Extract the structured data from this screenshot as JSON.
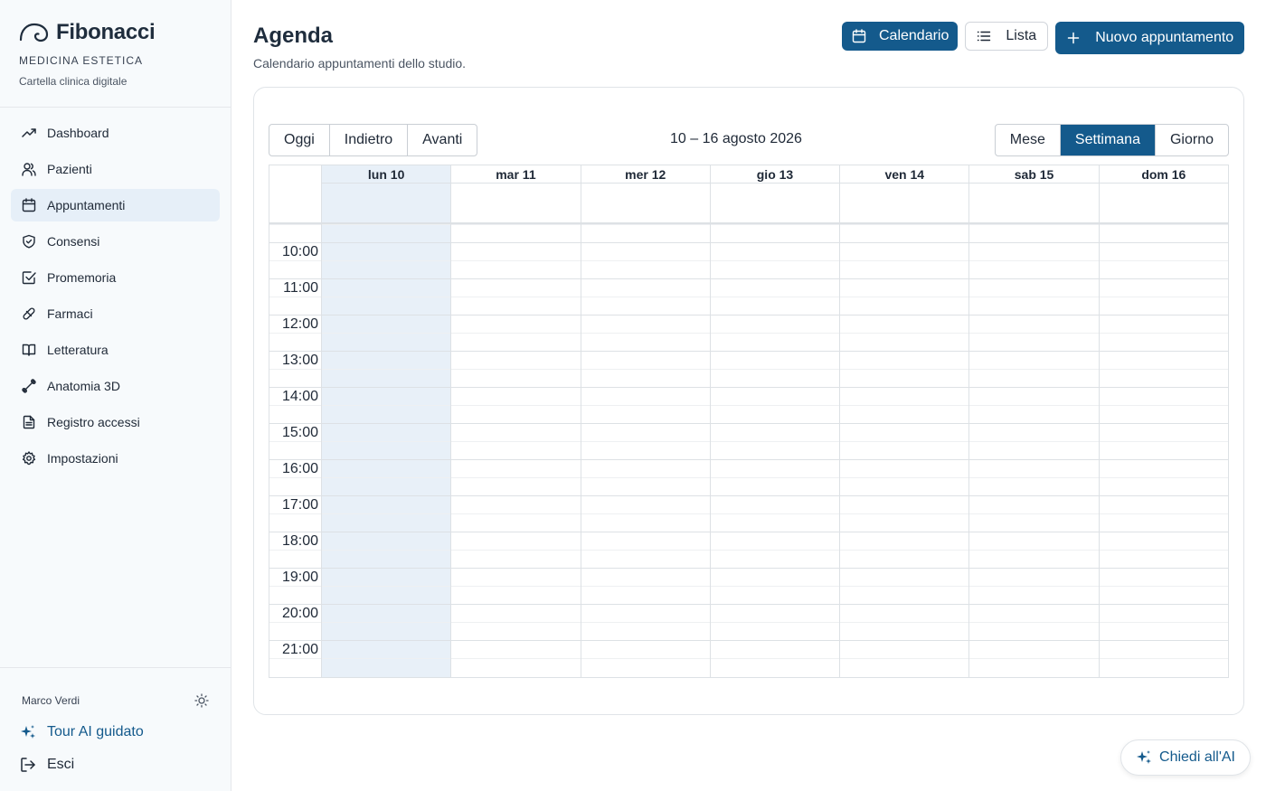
{
  "brand": {
    "name": "Fibonacci",
    "subtitle": "MEDICINA ESTETICA",
    "tagline": "Cartella clinica digitale"
  },
  "sidebar": {
    "items": [
      {
        "label": "Dashboard",
        "icon": "trending-up-icon"
      },
      {
        "label": "Pazienti",
        "icon": "users-icon"
      },
      {
        "label": "Appuntamenti",
        "icon": "calendar-icon",
        "active": true
      },
      {
        "label": "Consensi",
        "icon": "shield-check-icon"
      },
      {
        "label": "Promemoria",
        "icon": "checkbox-icon"
      },
      {
        "label": "Farmaci",
        "icon": "pill-icon"
      },
      {
        "label": "Letteratura",
        "icon": "book-open-icon"
      },
      {
        "label": "Anatomia 3D",
        "icon": "bone-icon"
      },
      {
        "label": "Registro accessi",
        "icon": "file-text-icon"
      },
      {
        "label": "Impostazioni",
        "icon": "gear-icon"
      }
    ],
    "user": "Marco Verdi",
    "tour": "Tour AI guidato",
    "logout": "Esci"
  },
  "page": {
    "title": "Agenda",
    "subtitle": "Calendario appuntamenti dello studio."
  },
  "actions": {
    "calendar_view": "Calendario",
    "list_view": "Lista",
    "new_appointment": "Nuovo appuntamento"
  },
  "calendar": {
    "nav": [
      "Oggi",
      "Indietro",
      "Avanti"
    ],
    "range": "10 – 16 agosto 2026",
    "views": [
      "Mese",
      "Settimana",
      "Giorno"
    ],
    "selected_view": "Settimana",
    "days": [
      "lun 10",
      "mar 11",
      "mer 12",
      "gio 13",
      "ven 14",
      "sab 15",
      "dom 16"
    ],
    "today": "lun 10",
    "hours": [
      "10:00",
      "11:00",
      "12:00",
      "13:00",
      "14:00",
      "15:00",
      "16:00",
      "17:00",
      "18:00",
      "19:00",
      "20:00",
      "21:00"
    ]
  },
  "ai_button": "Chiedi all'AI",
  "colors": {
    "primary": "#145a8c",
    "today_bg": "#e8f0f8",
    "sidebar_bg": "#f7fafc"
  }
}
